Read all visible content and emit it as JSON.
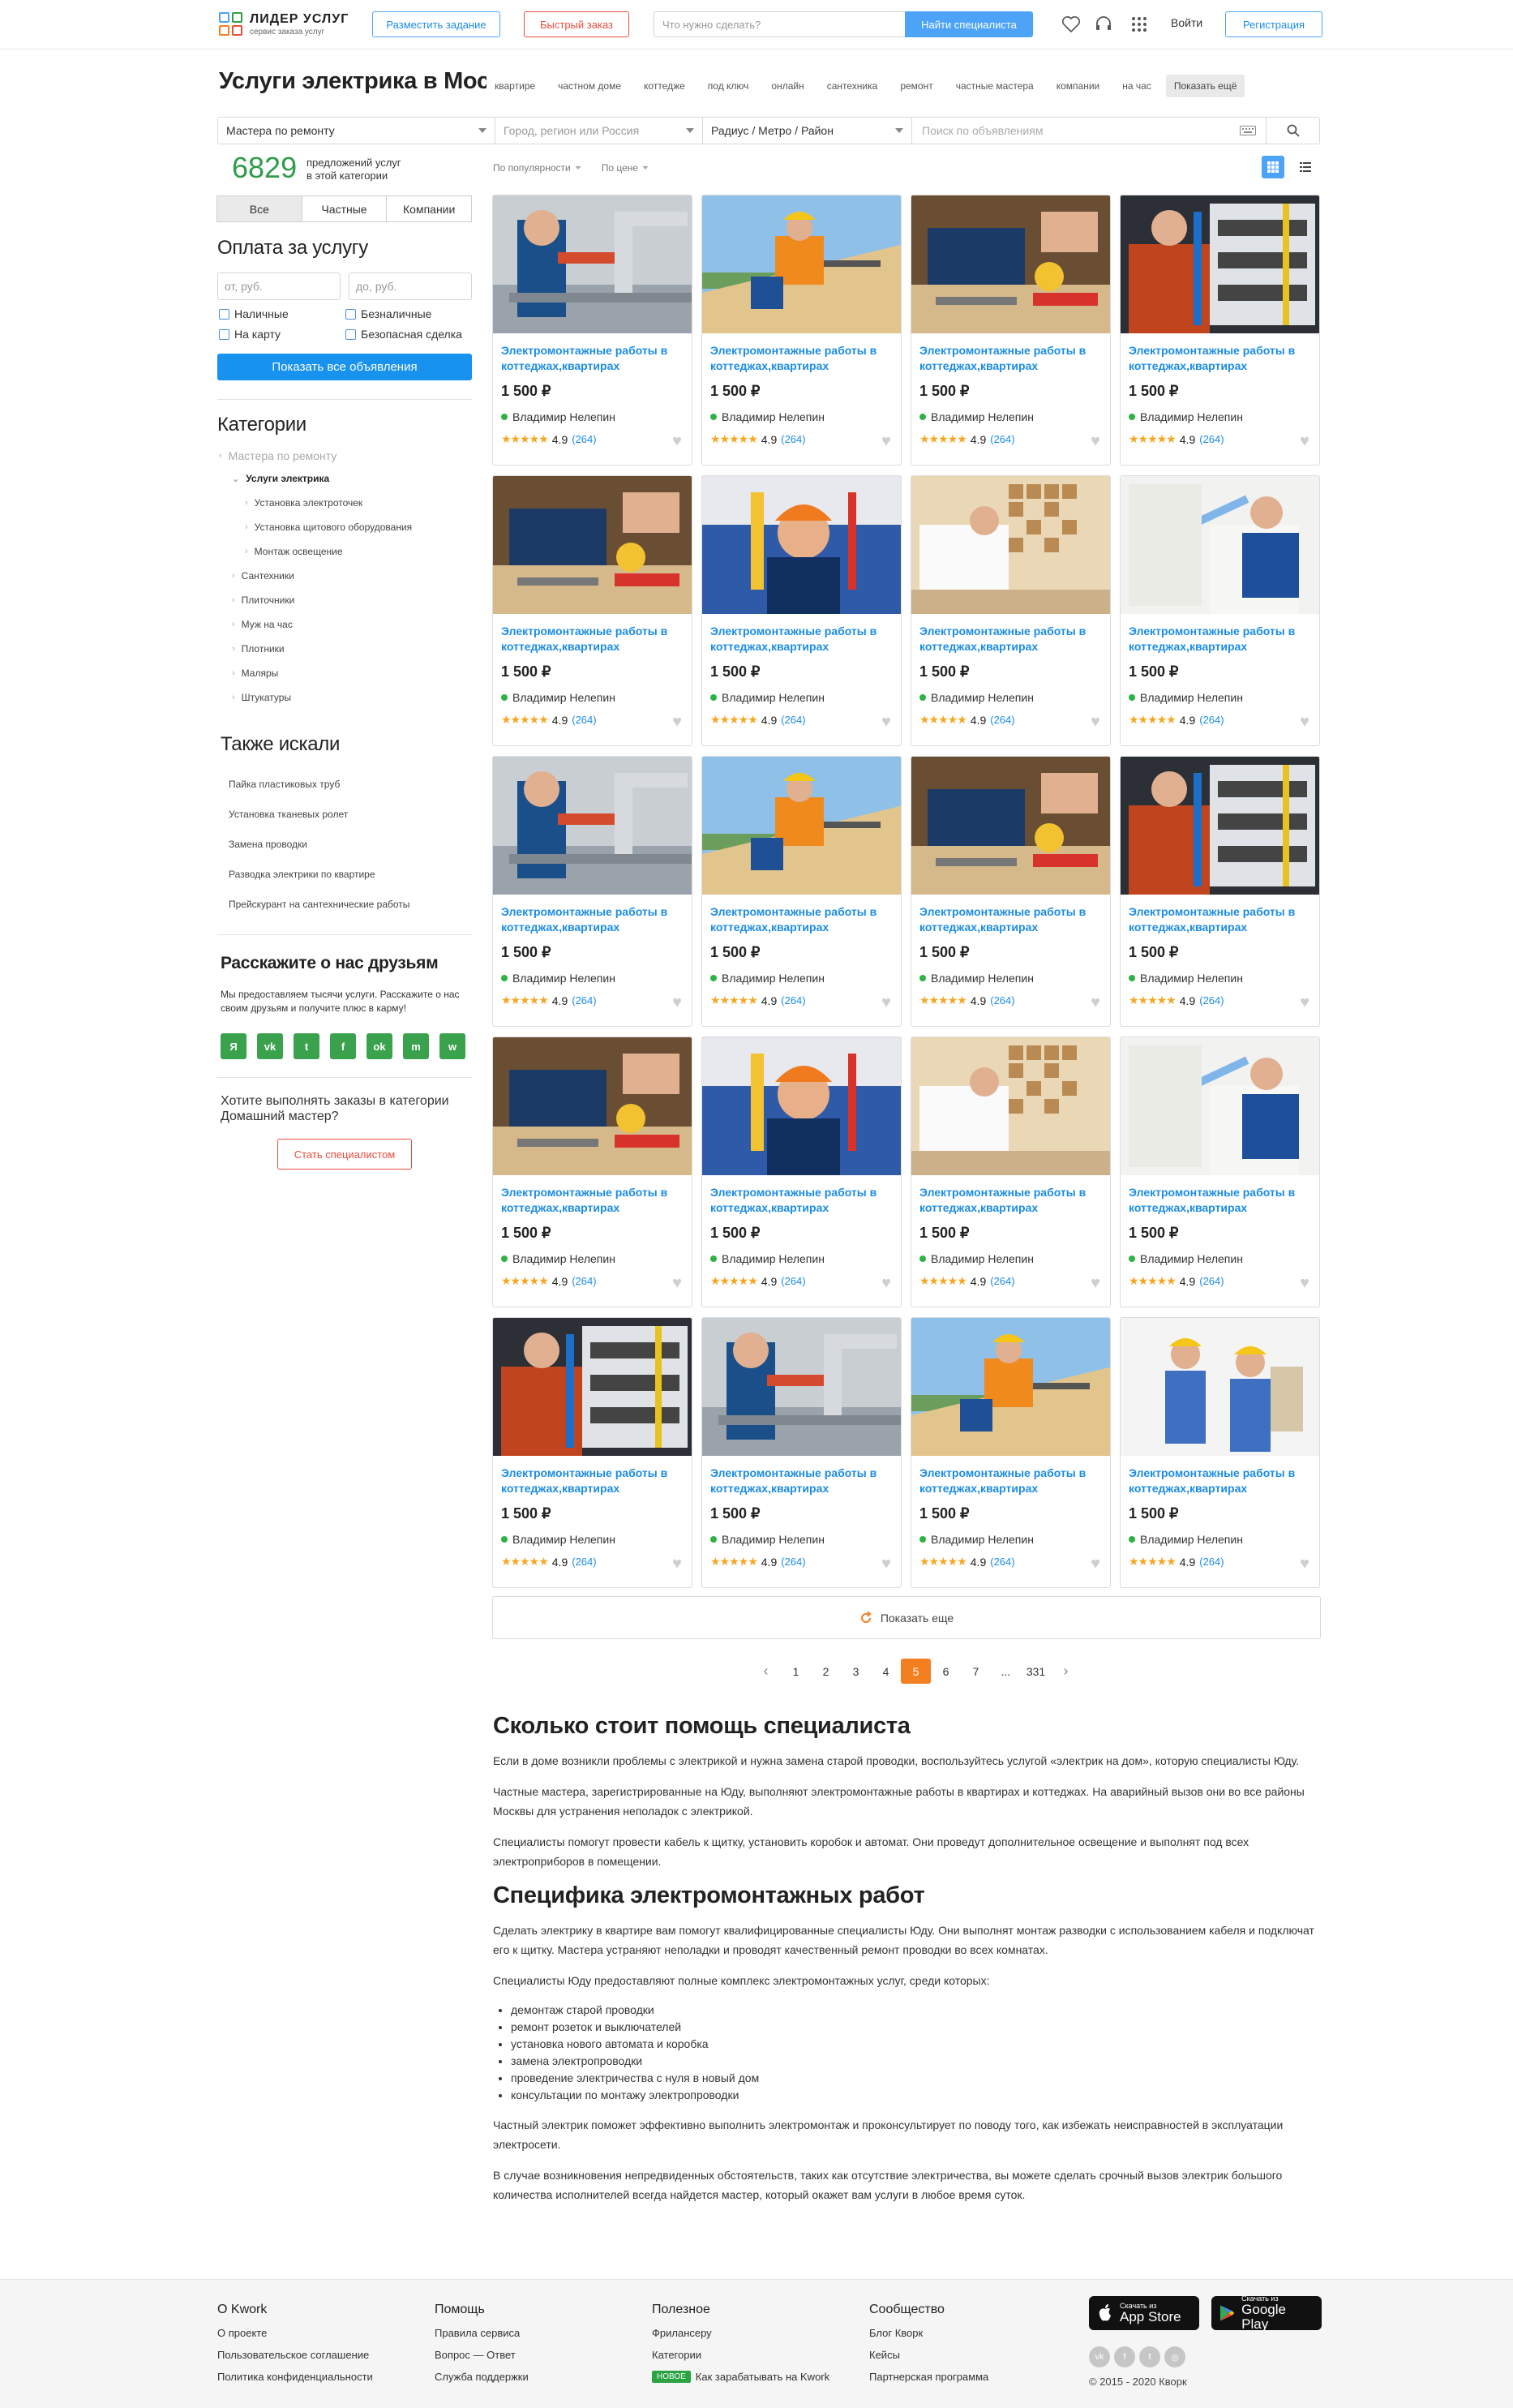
{
  "header": {
    "logo_title": "ЛИДЕР УСЛУГ",
    "logo_subtitle": "сервис заказа услуг",
    "post_task": "Разместить задание",
    "quick_order": "Быстрый заказ",
    "search_placeholder": "Что нужно сделать?",
    "find_specialist": "Найти специалиста",
    "login": "Войти",
    "register": "Регистрация"
  },
  "page": {
    "title": "Услуги электрика в Москве",
    "tags": [
      "квартире",
      "частном доме",
      "коттедже",
      "под ключ",
      "онлайн",
      "сантехника",
      "ремонт",
      "частные мастера",
      "компании",
      "на час"
    ],
    "show_more_tags": "Показать ещё"
  },
  "filters": {
    "category": "Мастера по ремонту",
    "city_placeholder": "Город, регион или Россия",
    "radius": "Радиус / Метро / Район",
    "ads_search_placeholder": "Поиск по объявлениям"
  },
  "sidebar": {
    "count": "6829",
    "count_text_1": "предложений услуг",
    "count_text_2": "в этой категории",
    "segments": [
      "Все",
      "Частные",
      "Компании"
    ],
    "payment_title": "Оплата за услугу",
    "price_from": "от, руб.",
    "price_to": "до, руб.",
    "payment_options": [
      "Наличные",
      "Безналичные",
      "На карту",
      "Безопасная сделка"
    ],
    "show_all": "Показать все объявления",
    "categories_title": "Категории",
    "back_category": "Мастера по ремонту",
    "current_category": "Услуги электрика",
    "subcategories": [
      "Установка электроточек",
      "Установка щитового оборудования",
      "Монтаж освещение"
    ],
    "siblings": [
      "Сантехники",
      "Плиточники",
      "Муж на час",
      "Плотники",
      "Маляры",
      "Штукатуры"
    ],
    "also_title": "Также искали",
    "also": [
      "Пайка пластиковых труб",
      "Установка тканевых ролет",
      "Замена проводки",
      "Разводка электрики по квартире",
      "Прейскурант на сантехнические работы"
    ],
    "share_title": "Расскажите о нас друзьям",
    "share_text": "Мы предоставляем тысячи услуги. Расскажите о нас своим друзьям и получите плюс в карму!",
    "social": [
      "Я",
      "vk",
      "t",
      "f",
      "ok",
      "m",
      "w"
    ],
    "become_question": "Хотите выполнять заказы в категории Домашний мастер?",
    "become_button": "Стать специалистом"
  },
  "sort": {
    "popular": "По популярности",
    "price": "По цене"
  },
  "cards": [
    {
      "title": "Электромонтажные работы в коттеджах,квартирах",
      "price": "1 500 ₽",
      "author": "Владимир Нелепин",
      "rating": "4.9",
      "reviews": "(264)",
      "img": "faucet"
    },
    {
      "title": "Электромонтажные работы в коттеджах,квартирах",
      "price": "1 500 ₽",
      "author": "Владимир Нелепин",
      "rating": "4.9",
      "reviews": "(264)",
      "img": "roof"
    },
    {
      "title": "Электромонтажные работы в коттеджах,квартирах",
      "price": "1 500 ₽",
      "author": "Владимир Нелепин",
      "rating": "4.9",
      "reviews": "(264)",
      "img": "tools"
    },
    {
      "title": "Электромонтажные работы в коттеджах,квартирах",
      "price": "1 500 ₽",
      "author": "Владимир Нелепин",
      "rating": "4.9",
      "reviews": "(264)",
      "img": "panel"
    },
    {
      "title": "Электромонтажные работы в коттеджах,квартирах",
      "price": "1 500 ₽",
      "author": "Владимир Нелепин",
      "rating": "4.9",
      "reviews": "(264)",
      "img": "tools"
    },
    {
      "title": "Электромонтажные работы в коттеджах,квартирах",
      "price": "1 500 ₽",
      "author": "Владимир Нелепин",
      "rating": "4.9",
      "reviews": "(264)",
      "img": "worker"
    },
    {
      "title": "Электромонтажные работы в коттеджах,квартирах",
      "price": "1 500 ₽",
      "author": "Владимир Нелепин",
      "rating": "4.9",
      "reviews": "(264)",
      "img": "tile"
    },
    {
      "title": "Электромонтажные работы в коттеджах,квартирах",
      "price": "1 500 ₽",
      "author": "Владимир Нелепин",
      "rating": "4.9",
      "reviews": "(264)",
      "img": "paint"
    },
    {
      "title": "Электромонтажные работы в коттеджах,квартирах",
      "price": "1 500 ₽",
      "author": "Владимир Нелепин",
      "rating": "4.9",
      "reviews": "(264)",
      "img": "faucet"
    },
    {
      "title": "Электромонтажные работы в коттеджах,квартирах",
      "price": "1 500 ₽",
      "author": "Владимир Нелепин",
      "rating": "4.9",
      "reviews": "(264)",
      "img": "roof"
    },
    {
      "title": "Электромонтажные работы в коттеджах,квартирах",
      "price": "1 500 ₽",
      "author": "Владимир Нелепин",
      "rating": "4.9",
      "reviews": "(264)",
      "img": "tools"
    },
    {
      "title": "Электромонтажные работы в коттеджах,квартирах",
      "price": "1 500 ₽",
      "author": "Владимир Нелепин",
      "rating": "4.9",
      "reviews": "(264)",
      "img": "panel"
    },
    {
      "title": "Электромонтажные работы в коттеджах,квартирах",
      "price": "1 500 ₽",
      "author": "Владимир Нелепин",
      "rating": "4.9",
      "reviews": "(264)",
      "img": "tools"
    },
    {
      "title": "Электромонтажные работы в коттеджах,квартирах",
      "price": "1 500 ₽",
      "author": "Владимир Нелепин",
      "rating": "4.9",
      "reviews": "(264)",
      "img": "worker"
    },
    {
      "title": "Электромонтажные работы в коттеджах,квартирах",
      "price": "1 500 ₽",
      "author": "Владимир Нелепин",
      "rating": "4.9",
      "reviews": "(264)",
      "img": "tile"
    },
    {
      "title": "Электромонтажные работы в коттеджах,квартирах",
      "price": "1 500 ₽",
      "author": "Владимир Нелепин",
      "rating": "4.9",
      "reviews": "(264)",
      "img": "paint"
    },
    {
      "title": "Электромонтажные работы в коттеджах,квартирах",
      "price": "1 500 ₽",
      "author": "Владимир Нелепин",
      "rating": "4.9",
      "reviews": "(264)",
      "img": "panel"
    },
    {
      "title": "Электромонтажные работы в коттеджах,квартирах",
      "price": "1 500 ₽",
      "author": "Владимир Нелепин",
      "rating": "4.9",
      "reviews": "(264)",
      "img": "faucet"
    },
    {
      "title": "Электромонтажные работы в коттеджах,квартирах",
      "price": "1 500 ₽",
      "author": "Владимир Нелепин",
      "rating": "4.9",
      "reviews": "(264)",
      "img": "roof"
    },
    {
      "title": "Электромонтажные работы в коттеджах,квартирах",
      "price": "1 500 ₽",
      "author": "Владимир Нелепин",
      "rating": "4.9",
      "reviews": "(264)",
      "img": "duo"
    }
  ],
  "show_more": "Показать еще",
  "pagination": [
    "1",
    "2",
    "3",
    "4",
    "5",
    "6",
    "7",
    "...",
    "331"
  ],
  "current_page": "5",
  "article": {
    "h1": "Сколько стоит помощь специалиста",
    "p1": "Если в доме возникли проблемы с электрикой и нужна замена старой проводки, воспользуйтесь услугой «электрик на дом», которую специалисты Юду.",
    "p2": "Частные мастера, зарегистрированные на Юду, выполняют электромонтажные работы в квартирах и коттеджах. На аварийный вызов они во все районы Москвы для устранения неполадок с электрикой.",
    "p3": "Специалисты помогут провести кабель к щитку, установить коробок и автомат. Они проведут дополнительное освещение и выполнят под всех электроприборов в помещении.",
    "h2": "Специфика электромонтажных работ",
    "p4": "Сделать электрику в квартире вам помогут квалифицированные специалисты Юду. Они выполнят монтаж разводки с использованием кабеля и подключат его к щитку. Мастера устраняют неполадки и проводят качественный ремонт проводки во всех комнатах.",
    "p5": "Специалисты Юду предоставляют полные комплекс электромонтажных услуг, среди которых:",
    "list": [
      "демонтаж старой проводки",
      "ремонт розеток и выключателей",
      "установка нового автомата и коробка",
      "замена электропроводки",
      "проведение электричества с нуля в новый дом",
      "консультации по монтажу электропроводки"
    ],
    "p6": "Частный электрик поможет эффективно выполнить электромонтаж и проконсультирует по поводу того, как избежать неисправностей в эксплуатации электросети.",
    "p7": "В случае возникновения непредвиденных обстоятельств, таких как отсутствие электричества, вы можете сделать срочный вызов электрик большого количества исполнителей всегда найдется мастер, который окажет вам услуги в любое время суток."
  },
  "footer": {
    "col1_title": "О Kwork",
    "col1": [
      "О проекте",
      "Пользовательское соглашение",
      "Политика конфиденциальности"
    ],
    "col2_title": "Помощь",
    "col2": [
      "Правила сервиса",
      "Вопрос — Ответ",
      "Служба поддержки"
    ],
    "col3_title": "Полезное",
    "col3": [
      "Фрилансеру",
      "Категории",
      "Как зарабатывать на Kwork"
    ],
    "new_badge": "НОВОЕ",
    "col4_title": "Сообщество",
    "col4": [
      "Блог Кворк",
      "Кейсы",
      "Партнерская программа"
    ],
    "appstore_small": "Скачать из",
    "appstore": "App Store",
    "gplay_small": "Скачать из",
    "gplay": "Google Play",
    "copyright": "© 2015 - 2020 Кворк"
  },
  "colors": {
    "brand_blue": "#1792ef",
    "accent_orange": "#f47f20",
    "green": "#2f9c4a",
    "red": "#e94c3d"
  }
}
